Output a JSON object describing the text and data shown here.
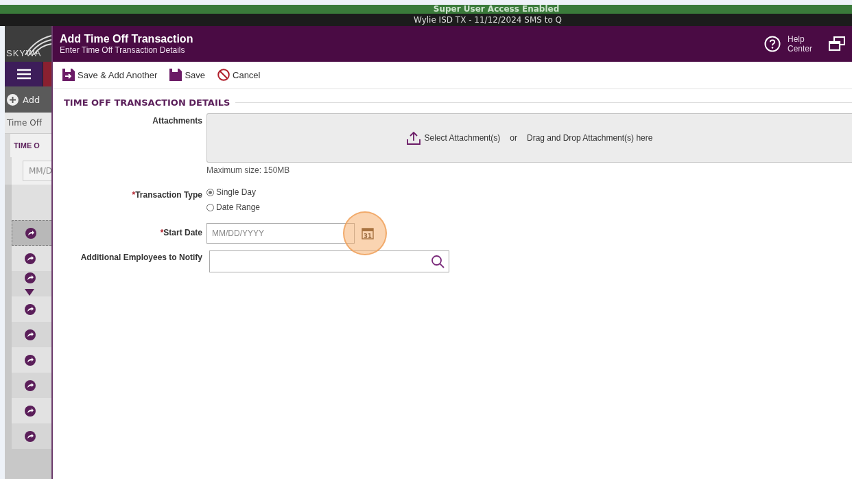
{
  "banner": {
    "text": "Super User Access Enabled"
  },
  "environment_bar": {
    "text": "Wylie ISD TX - 11/12/2024 SMS to Q"
  },
  "background_app": {
    "logo_text": "SKYWA",
    "add_button": "Add",
    "breadcrumb": "Time Off",
    "section_title": "TIME O",
    "date_placeholder": "MM/D",
    "rows": [
      {
        "selected": true,
        "has_caret": false
      },
      {
        "selected": false,
        "has_caret": false
      },
      {
        "selected": false,
        "has_caret": true
      },
      {
        "selected": false,
        "has_caret": false
      },
      {
        "selected": false,
        "has_caret": false
      },
      {
        "selected": false,
        "has_caret": false
      },
      {
        "selected": false,
        "has_caret": false
      },
      {
        "selected": false,
        "has_caret": false
      },
      {
        "selected": false,
        "has_caret": false
      }
    ]
  },
  "dialog": {
    "title": "Add Time Off Transaction",
    "subtitle": "Enter Time Off Transaction Details",
    "help": "Help Center",
    "toolbar": [
      {
        "kind": "save-add",
        "label": "Save & Add Another"
      },
      {
        "kind": "save",
        "label": "Save"
      },
      {
        "kind": "cancel",
        "label": "Cancel"
      }
    ],
    "section_title": "TIME OFF TRANSACTION DETAILS",
    "attachments": {
      "label": "Attachments",
      "select": "Select Attachment(s)",
      "or": "or",
      "drop": "Drag and Drop Attachment(s) here",
      "note": "Maximum size: 150MB"
    },
    "transaction_type": {
      "required_mark": "*",
      "label": "Transaction Type",
      "options": [
        {
          "label": "Single Day",
          "selected": true
        },
        {
          "label": "Date Range",
          "selected": false
        }
      ]
    },
    "start_date": {
      "required_mark": "*",
      "label": "Start Date",
      "placeholder": "MM/DD/YYYY",
      "calendar_day": "31"
    },
    "notify": {
      "label": "Additional Employees to Notify"
    }
  }
}
